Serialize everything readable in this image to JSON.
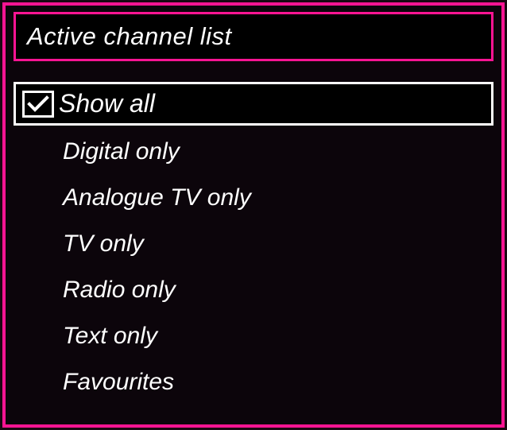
{
  "title": "Active channel list",
  "items": [
    {
      "label": "Show all",
      "selected": true,
      "checked": true
    },
    {
      "label": "Digital only",
      "selected": false,
      "checked": false
    },
    {
      "label": "Analogue TV only",
      "selected": false,
      "checked": false
    },
    {
      "label": "TV only",
      "selected": false,
      "checked": false
    },
    {
      "label": "Radio only",
      "selected": false,
      "checked": false
    },
    {
      "label": "Text only",
      "selected": false,
      "checked": false
    },
    {
      "label": "Favourites",
      "selected": false,
      "checked": false
    }
  ]
}
